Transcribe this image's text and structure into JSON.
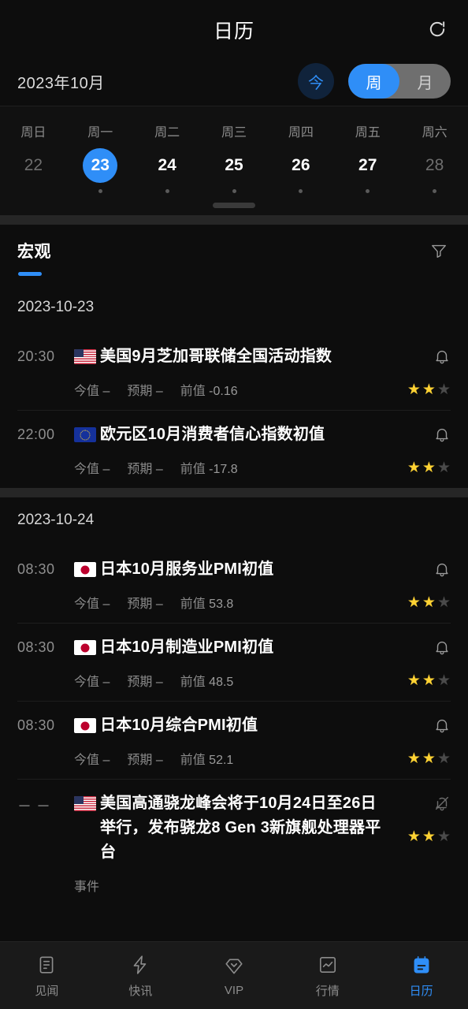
{
  "header": {
    "title": "日历",
    "refresh_icon": "refresh-icon"
  },
  "month_bar": {
    "month_label": "2023年10月",
    "today_button": "今",
    "view_toggle": {
      "options": [
        "周",
        "月"
      ],
      "selected": "周"
    }
  },
  "week_strip": {
    "weekday_labels": [
      "周日",
      "周一",
      "周二",
      "周三",
      "周四",
      "周五",
      "周六"
    ],
    "days": [
      {
        "num": "22",
        "selected": false,
        "dimmed": true,
        "has_event": false
      },
      {
        "num": "23",
        "selected": true,
        "dimmed": false,
        "has_event": true
      },
      {
        "num": "24",
        "selected": false,
        "dimmed": false,
        "has_event": true
      },
      {
        "num": "25",
        "selected": false,
        "dimmed": false,
        "has_event": true
      },
      {
        "num": "26",
        "selected": false,
        "dimmed": false,
        "has_event": true
      },
      {
        "num": "27",
        "selected": false,
        "dimmed": false,
        "has_event": true
      },
      {
        "num": "28",
        "selected": false,
        "dimmed": true,
        "has_event": true
      }
    ]
  },
  "category_bar": {
    "active_tab": "宏观",
    "filter_icon": "filter-icon"
  },
  "labels": {
    "actual": "今值",
    "forecast": "预期",
    "previous": "前值",
    "event_tag": "事件",
    "dash": "–"
  },
  "groups": [
    {
      "date": "2023-10-23",
      "events": [
        {
          "time": "20:30",
          "flag": "us",
          "title": "美国9月芝加哥联储全国活动指数",
          "actual": "–",
          "forecast": "–",
          "previous": "-0.16",
          "stars": 2,
          "max_stars": 3,
          "bell": "bell-icon"
        },
        {
          "time": "22:00",
          "flag": "eu",
          "title": "欧元区10月消费者信心指数初值",
          "actual": "–",
          "forecast": "–",
          "previous": "-17.8",
          "stars": 2,
          "max_stars": 3,
          "bell": "bell-icon"
        }
      ]
    },
    {
      "date": "2023-10-24",
      "events": [
        {
          "time": "08:30",
          "flag": "jp",
          "title": "日本10月服务业PMI初值",
          "actual": "–",
          "forecast": "–",
          "previous": "53.8",
          "stars": 2,
          "max_stars": 3,
          "bell": "bell-icon"
        },
        {
          "time": "08:30",
          "flag": "jp",
          "title": "日本10月制造业PMI初值",
          "actual": "–",
          "forecast": "–",
          "previous": "48.5",
          "stars": 2,
          "max_stars": 3,
          "bell": "bell-icon"
        },
        {
          "time": "08:30",
          "flag": "jp",
          "title": "日本10月综合PMI初值",
          "actual": "–",
          "forecast": "–",
          "previous": "52.1",
          "stars": 2,
          "max_stars": 3,
          "bell": "bell-icon"
        },
        {
          "time": "－ －",
          "flag": "us",
          "title": "美国高通骁龙峰会将于10月24日至26日举行，发布骁龙8 Gen 3新旗舰处理器平台",
          "tag": "事件",
          "stars": 2,
          "max_stars": 3,
          "bell": "bell-off-icon"
        }
      ]
    }
  ],
  "bottom_nav": {
    "items": [
      {
        "label": "见闻",
        "icon": "document-icon",
        "active": false
      },
      {
        "label": "快讯",
        "icon": "lightning-icon",
        "active": false
      },
      {
        "label": "VIP",
        "icon": "diamond-icon",
        "active": false
      },
      {
        "label": "行情",
        "icon": "chart-icon",
        "active": false
      },
      {
        "label": "日历",
        "icon": "calendar-icon",
        "active": true
      }
    ]
  },
  "colors": {
    "accent": "#2f8ef7",
    "star_on": "#ffd233",
    "star_off": "#4a4a4a",
    "background": "#0d0d0d",
    "nav_background": "#1a1a1a"
  }
}
